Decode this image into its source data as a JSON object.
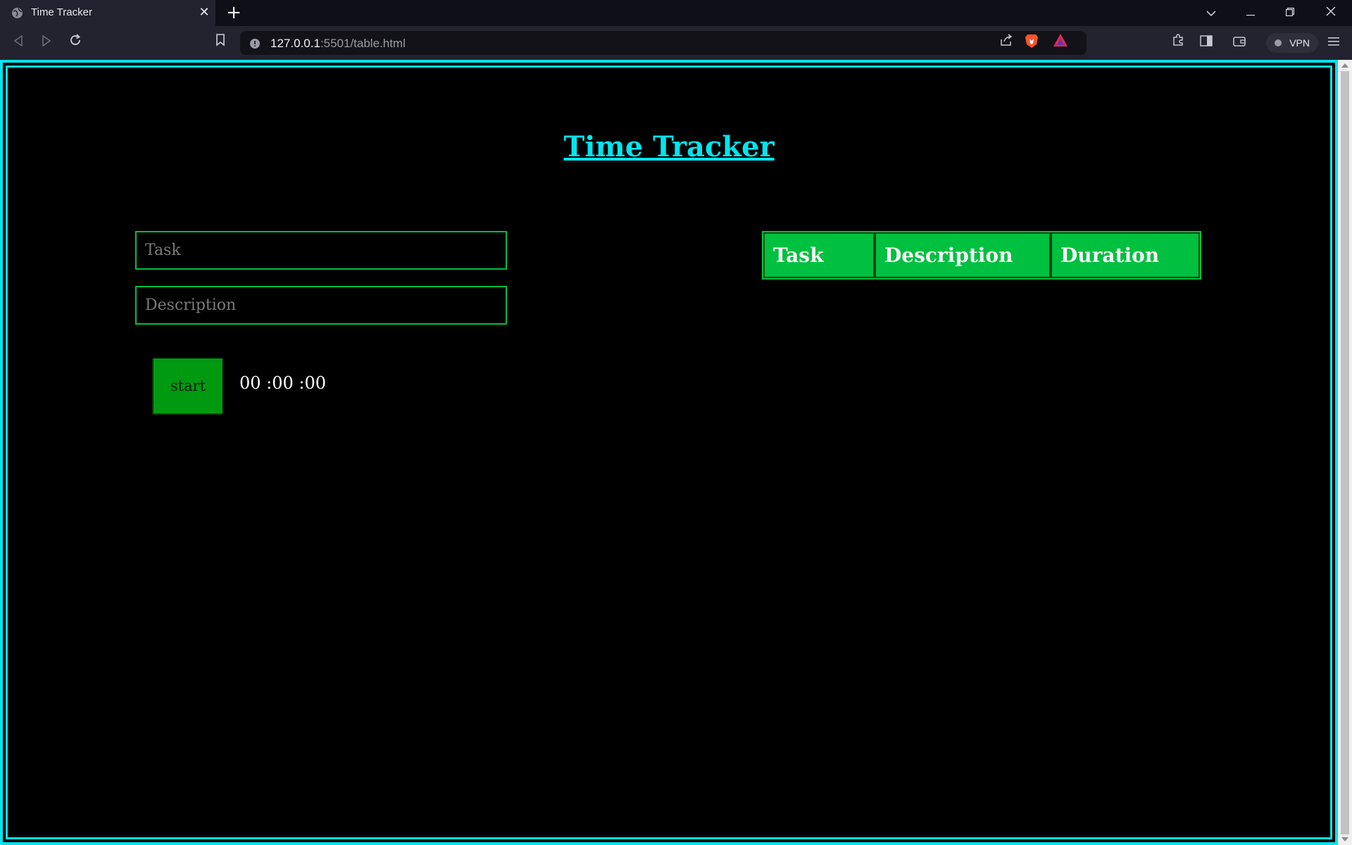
{
  "browser": {
    "tab_title": "Time Tracker",
    "url_host": "127.0.0.1",
    "url_rest": ":5501/table.html",
    "vpn_label": "VPN"
  },
  "page": {
    "title": "Time Tracker",
    "task_input": {
      "placeholder": "Task",
      "value": ""
    },
    "description_input": {
      "placeholder": "Description",
      "value": ""
    },
    "start_label": "start",
    "timer": "00 :00 :00",
    "table_headers": [
      "Task",
      "Description",
      "Duration"
    ]
  },
  "colors": {
    "frame": "#00e5ee",
    "title": "#00e5ee",
    "field_border": "#00c040",
    "table_header_bg": "#00c040",
    "start_button_bg": "#009a10"
  }
}
